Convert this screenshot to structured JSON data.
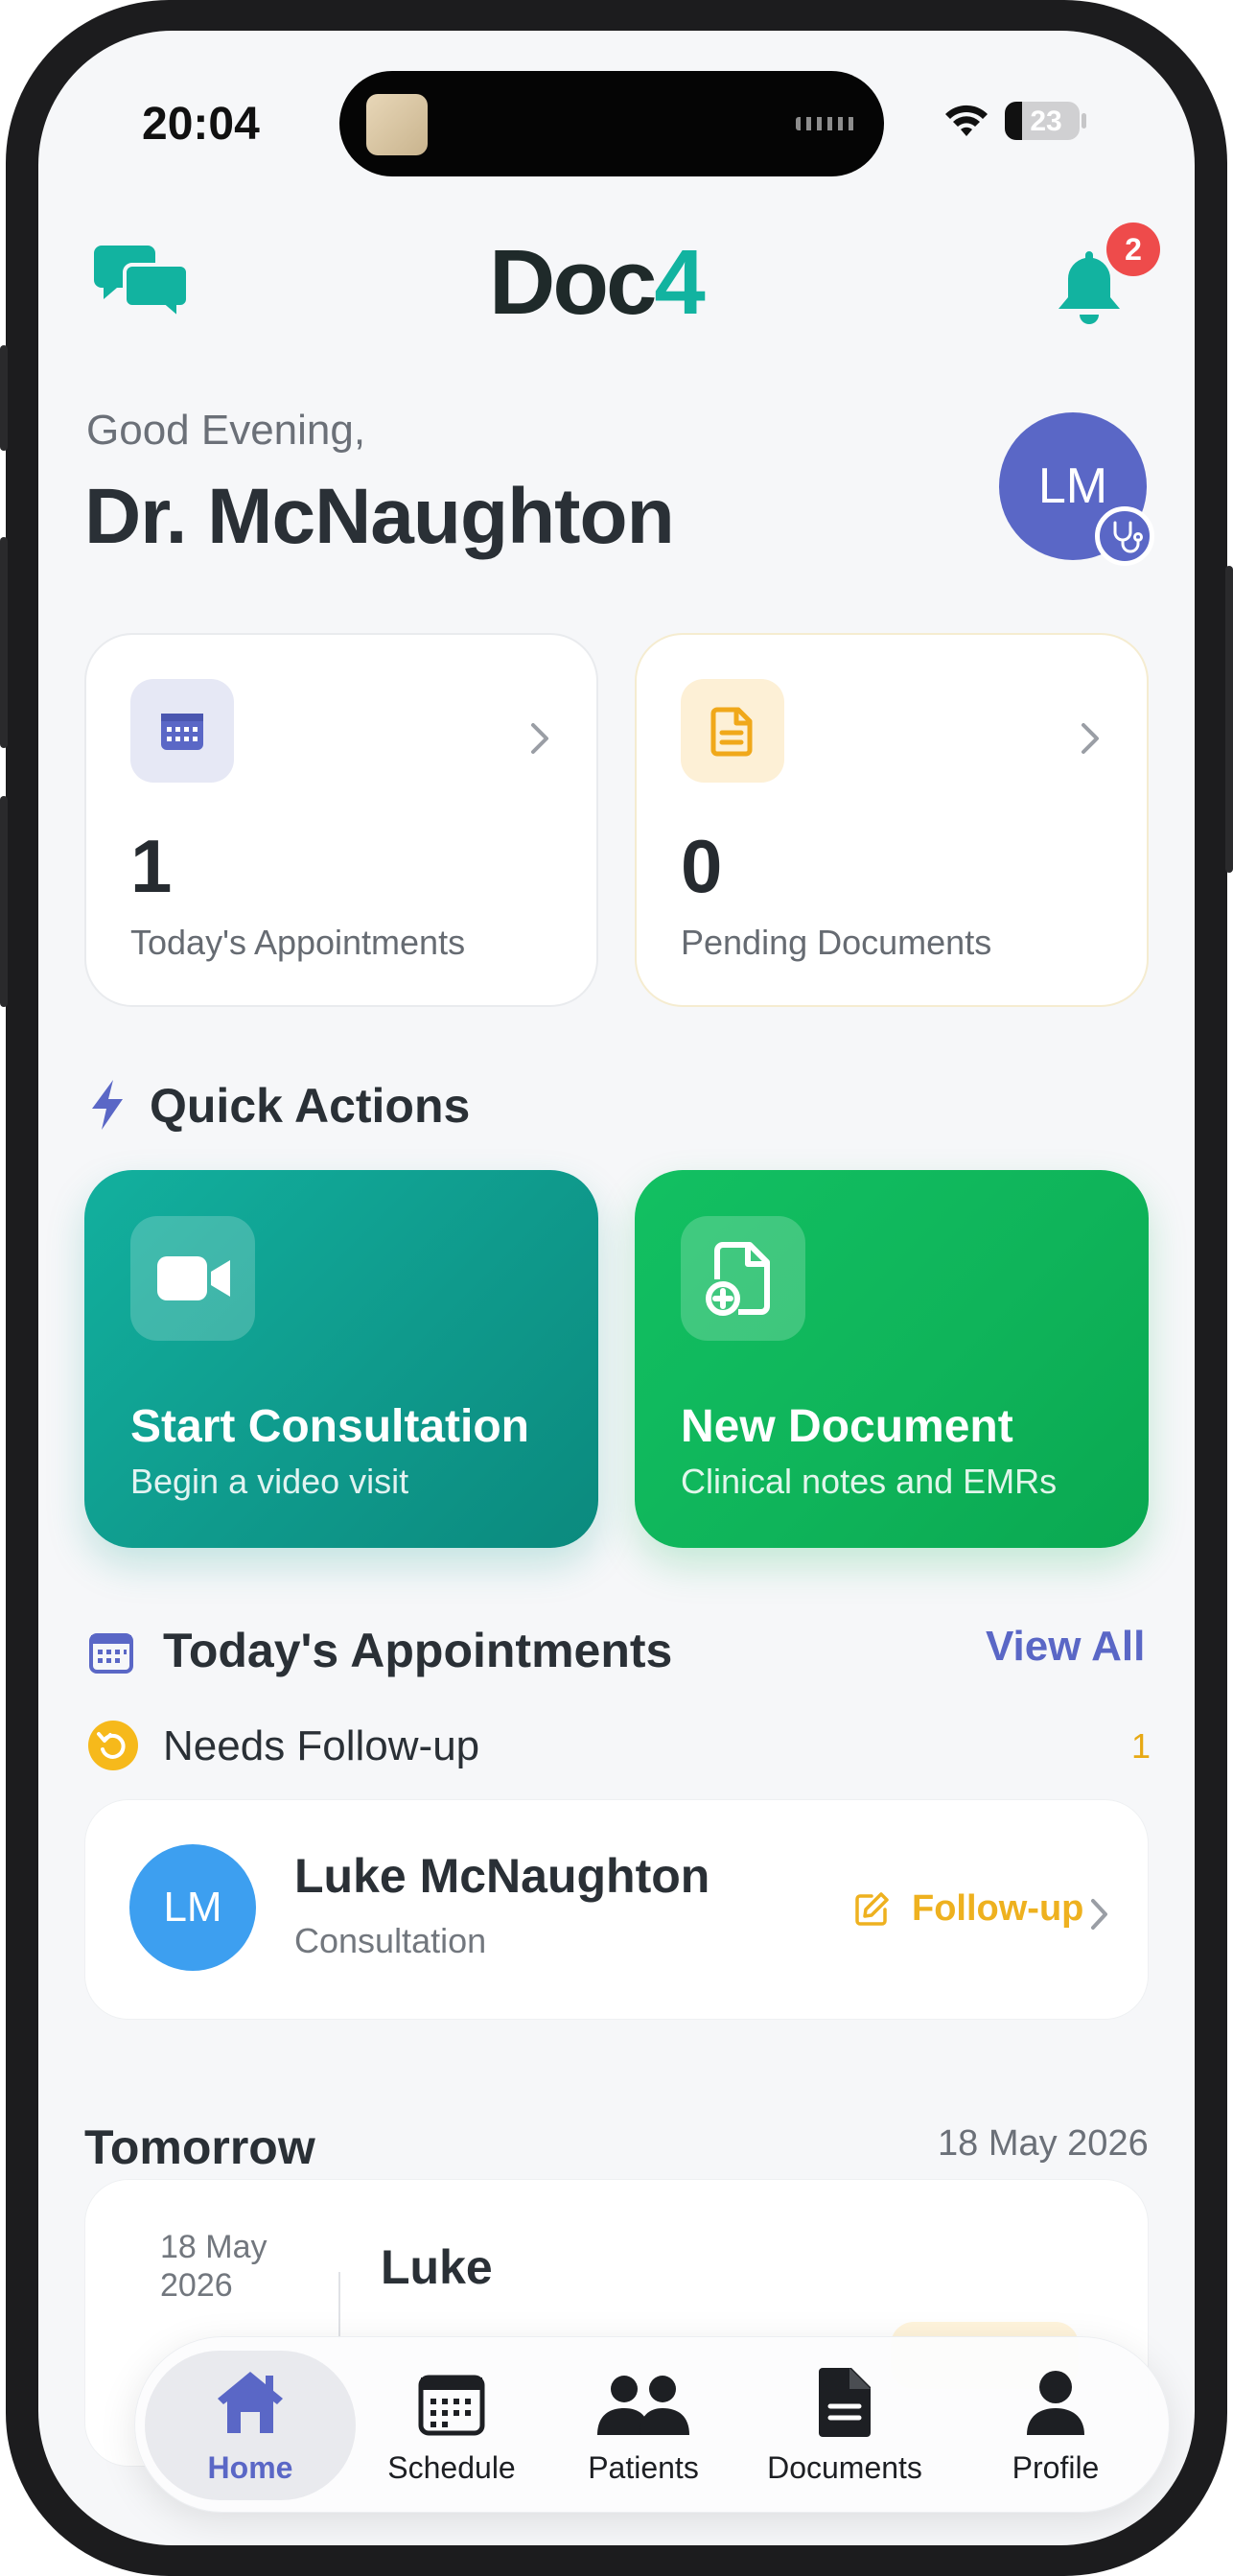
{
  "status_bar": {
    "time": "20:04",
    "battery": "23"
  },
  "header": {
    "logo_main": "Doc",
    "logo_accent": "4",
    "notification_count": "2"
  },
  "greeting": {
    "salutation": "Good Evening,",
    "doctor_name": "Dr. McNaughton",
    "avatar_initials": "LM"
  },
  "stats": [
    {
      "value": "1",
      "label": "Today's Appointments",
      "icon": "calendar-icon"
    },
    {
      "value": "0",
      "label": "Pending Documents",
      "icon": "document-icon"
    }
  ],
  "quick_actions": {
    "title": "Quick Actions",
    "items": [
      {
        "label": "Start Consultation",
        "sub": "Begin a video visit",
        "icon": "video-camera-icon"
      },
      {
        "label": "New Document",
        "sub": "Clinical notes and EMRs",
        "icon": "document-add-icon"
      }
    ]
  },
  "todays_appointments": {
    "title": "Today's Appointments",
    "view_all": "View All",
    "follow_up_section": {
      "title": "Needs Follow-up",
      "count": "1"
    },
    "items": [
      {
        "initials": "LM",
        "name": "Luke McNaughton",
        "type": "Consultation",
        "action": "Follow-up"
      }
    ]
  },
  "tomorrow": {
    "title": "Tomorrow",
    "date": "18 May 2026",
    "items": [
      {
        "date": "18 May 2026",
        "name": "Luke"
      }
    ]
  },
  "tabbar": {
    "active": "Home",
    "items": [
      {
        "label": "Home",
        "icon": "home-icon"
      },
      {
        "label": "Schedule",
        "icon": "calendar-icon"
      },
      {
        "label": "Patients",
        "icon": "people-icon"
      },
      {
        "label": "Documents",
        "icon": "document-icon"
      },
      {
        "label": "Profile",
        "icon": "person-icon"
      }
    ]
  },
  "colors": {
    "accent": "#5a67c6",
    "teal": "#12b3a0",
    "green": "#10b85c",
    "badge_red": "#ee4b4b",
    "follow_up_amber": "#eeb11f"
  }
}
